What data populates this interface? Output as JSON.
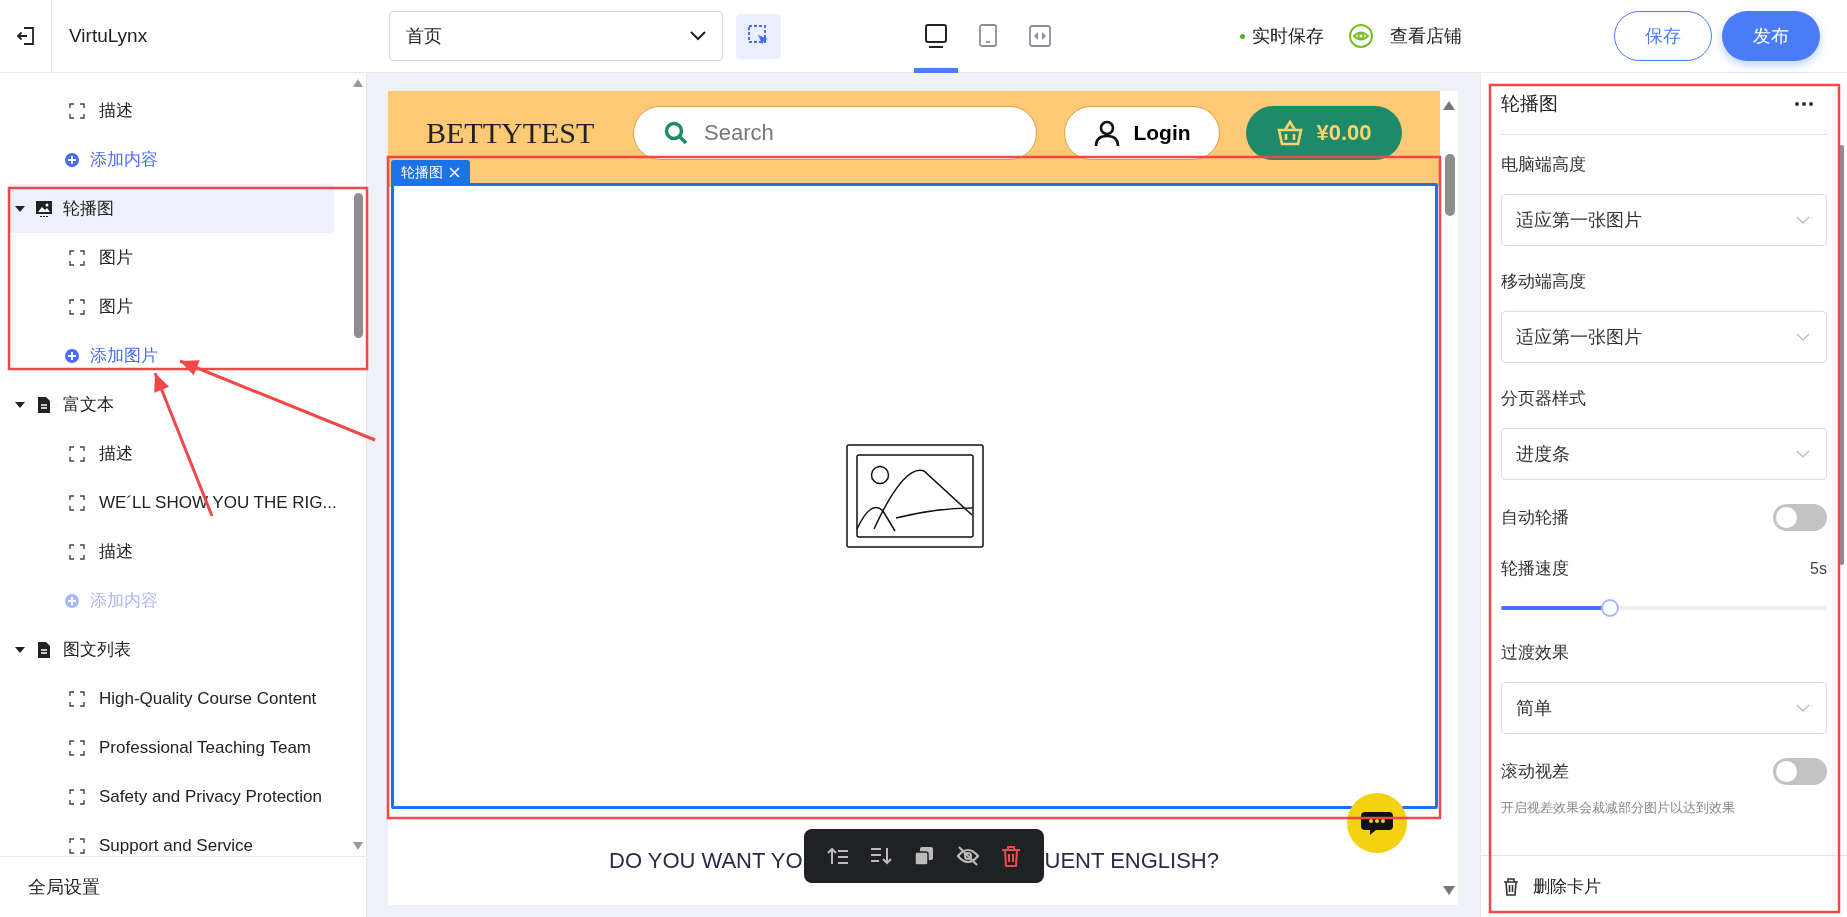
{
  "topbar": {
    "brand": "VirtuLynx",
    "page_select": {
      "value": "首页"
    },
    "select_tool": {
      "selected": true
    },
    "devices": [
      {
        "kind": "desktop",
        "selected": true
      },
      {
        "kind": "mobile",
        "selected": false
      },
      {
        "kind": "fit",
        "selected": false
      }
    ],
    "autosave": "实时保存",
    "view_store": "查看店铺",
    "buttons": [
      {
        "label": "保存",
        "kind": "outline"
      },
      {
        "label": "发布",
        "kind": "primary"
      }
    ]
  },
  "sidebar": {
    "tree": [
      {
        "kind": "leaf",
        "label": "描述"
      },
      {
        "kind": "add",
        "label": "添加内容",
        "disabled": false
      },
      {
        "kind": "gallery",
        "label": "轮播图",
        "expanded": true,
        "selected": true,
        "children": [
          {
            "kind": "leaf",
            "label": "图片"
          },
          {
            "kind": "leaf",
            "label": "图片"
          },
          {
            "kind": "add",
            "label": "添加图片",
            "disabled": false
          }
        ]
      },
      {
        "kind": "document",
        "label": "富文本",
        "expanded": true,
        "selected": false,
        "children": [
          {
            "kind": "leaf",
            "label": "描述"
          },
          {
            "kind": "leaf",
            "label": "WE´LL SHOW YOU THE RIG..."
          },
          {
            "kind": "leaf",
            "label": "描述"
          },
          {
            "kind": "add",
            "label": "添加内容",
            "disabled": true
          }
        ]
      },
      {
        "kind": "document",
        "label": "图文列表",
        "expanded": true,
        "selected": false,
        "children": [
          {
            "kind": "leaf",
            "label": "High-Quality Course Content"
          },
          {
            "kind": "leaf",
            "label": "Professional Teaching Team"
          },
          {
            "kind": "leaf",
            "label": "Safety and Privacy Protection"
          },
          {
            "kind": "leaf",
            "label": "Support and Service"
          }
        ]
      }
    ],
    "footer": "全局设置"
  },
  "canvas": {
    "store_header": {
      "logo": "BETTYTEST",
      "search_placeholder": "Search",
      "login": "Login",
      "cart": "¥0.00"
    },
    "selection_tag": "轮播图",
    "heading_parts": [
      "DO YOU WANT YO",
      "UENT ENGLISH?"
    ],
    "toolbar": [
      {
        "kind": "move_up"
      },
      {
        "kind": "move_down"
      },
      {
        "kind": "copy"
      },
      {
        "kind": "hide"
      },
      {
        "kind": "delete"
      }
    ]
  },
  "panel": {
    "title": "轮播图",
    "fields": [
      {
        "kind": "select",
        "label": "电脑端高度",
        "value": "适应第一张图片"
      },
      {
        "kind": "select",
        "label": "移动端高度",
        "value": "适应第一张图片"
      },
      {
        "kind": "select",
        "label": "分页器样式",
        "value": "进度条"
      },
      {
        "kind": "toggle",
        "label": "自动轮播",
        "on": false
      },
      {
        "kind": "slider",
        "label": "轮播速度",
        "reading": "5s",
        "level": 0.33
      },
      {
        "kind": "select",
        "label": "过渡效果",
        "value": "简单"
      },
      {
        "kind": "toggle",
        "label": "滚动视差",
        "on": false,
        "hint": "开启视差效果会裁减部分图片以达到效果"
      }
    ],
    "delete": "删除卡片"
  },
  "annotations": [
    {
      "kind": "frame"
    },
    {
      "kind": "frame"
    },
    {
      "kind": "frame"
    },
    {
      "kind": "arrow"
    },
    {
      "kind": "arrow"
    }
  ]
}
